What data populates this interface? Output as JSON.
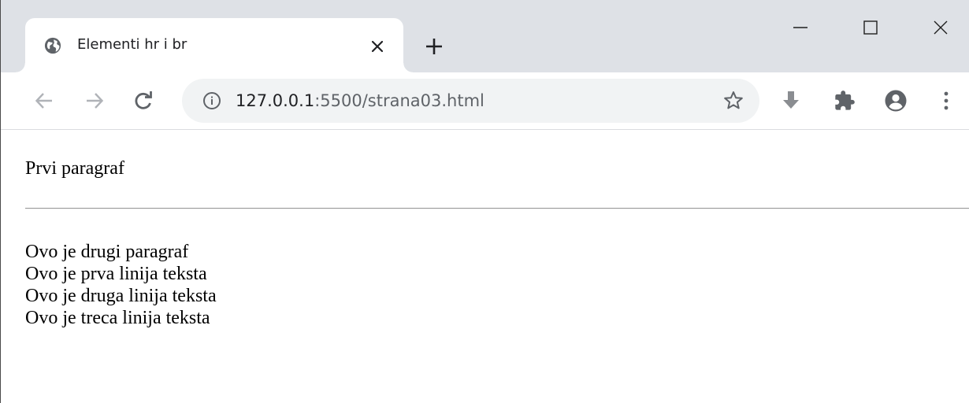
{
  "tab": {
    "title": "Elementi hr i br",
    "favicon": "globe-icon",
    "close_icon": "close-icon"
  },
  "tabstrip": {
    "new_tab_icon": "plus-icon"
  },
  "window_controls": {
    "minimize_icon": "minimize-icon",
    "maximize_icon": "maximize-icon",
    "close_icon": "close-icon"
  },
  "toolbar": {
    "back_icon": "arrow-left-icon",
    "forward_icon": "arrow-right-icon",
    "reload_icon": "reload-icon",
    "url_host": "127.0.0.1",
    "url_rest": ":5500/strana03.html",
    "info_icon": "info-icon",
    "bookmark_icon": "star-icon",
    "download_icon": "download-icon",
    "extensions_icon": "puzzle-icon",
    "profile_icon": "account-icon",
    "menu_icon": "kebab-menu-icon"
  },
  "page": {
    "paragraph1": "Prvi paragraf",
    "paragraph2_lines": [
      "Ovo je drugi paragraf",
      "Ovo je prva linija teksta",
      "Ovo je druga linija teksta",
      "Ovo je treca linija teksta"
    ]
  },
  "colors": {
    "tabstrip_bg": "#dee1e6",
    "omnibox_bg": "#f1f3f4",
    "icon_gray": "#5f6368",
    "text": "#202124"
  }
}
